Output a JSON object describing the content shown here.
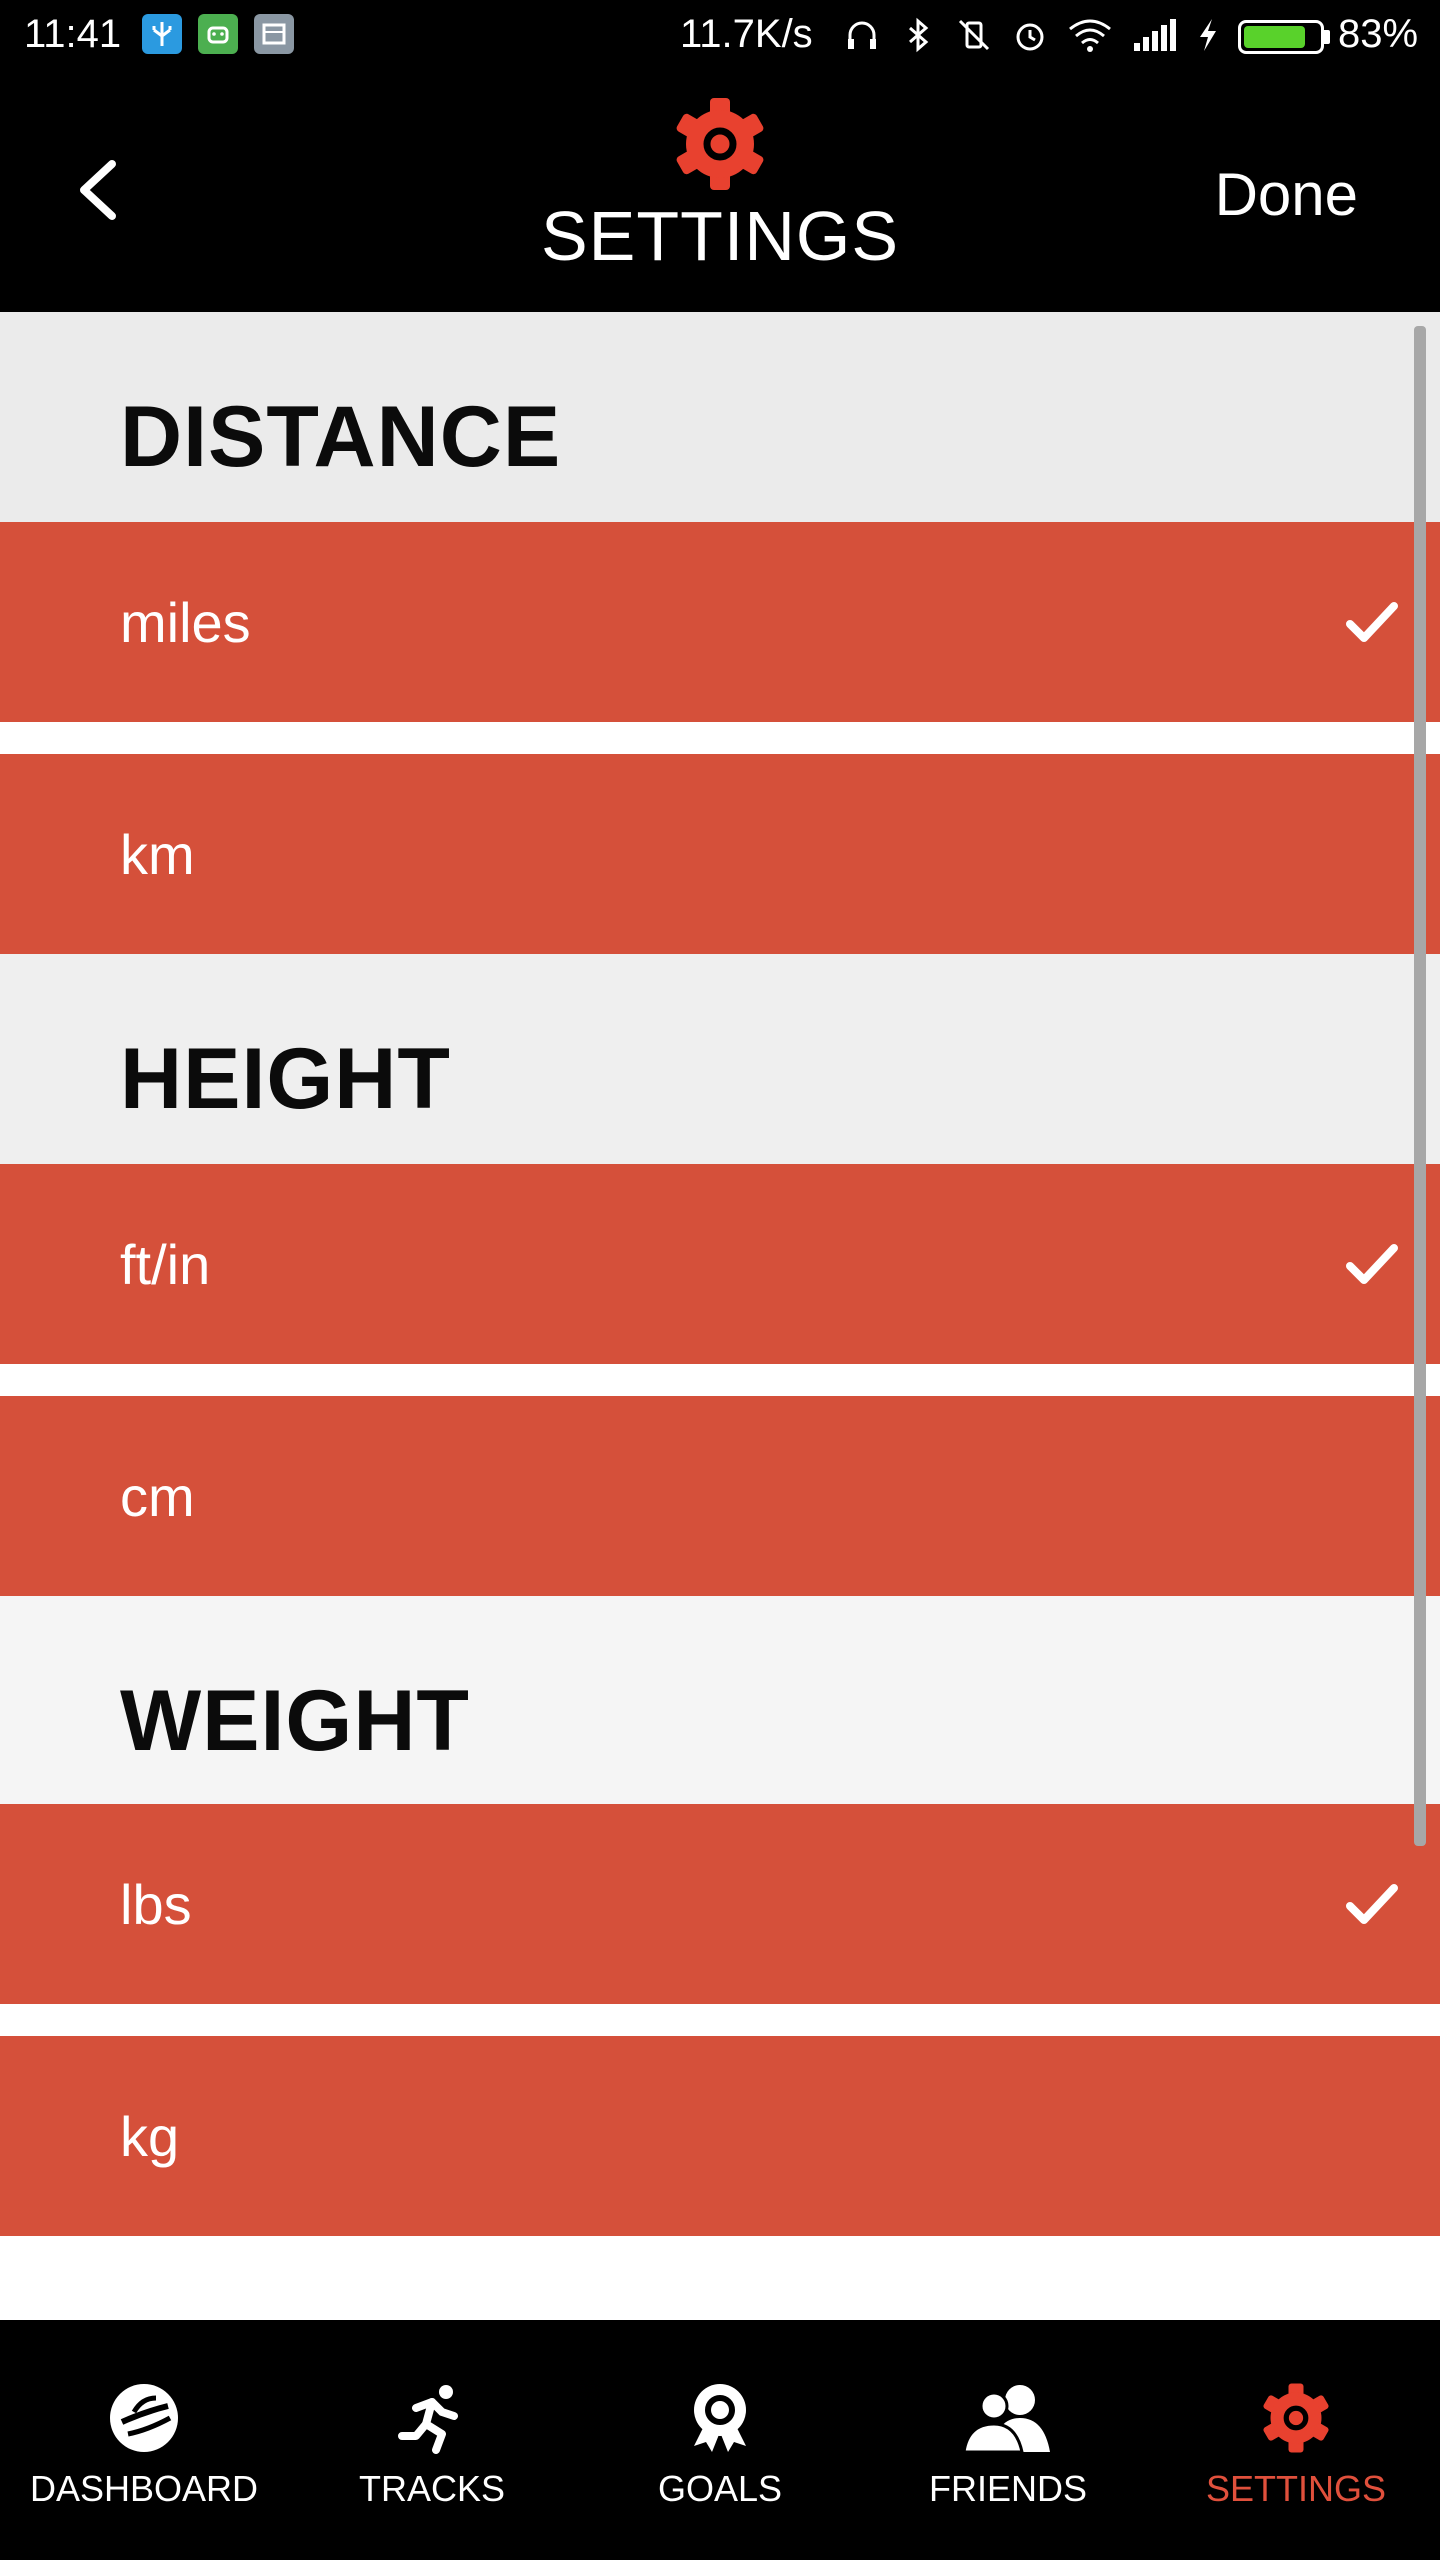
{
  "status_bar": {
    "time": "11:41",
    "network_speed": "11.7K/s",
    "battery_percent": "83%",
    "battery_level": 0.83,
    "icons": [
      "usb-icon",
      "android-icon",
      "message-icon",
      "headphones-icon",
      "bluetooth-icon",
      "vibrate-off-icon",
      "alarm-icon",
      "wifi-icon",
      "signal-icon",
      "charging-icon",
      "battery-icon"
    ]
  },
  "header": {
    "title": "SETTINGS",
    "done_label": "Done",
    "icon": "gear-icon"
  },
  "sections": [
    {
      "title": "DISTANCE",
      "options": [
        {
          "label": "miles",
          "selected": true
        },
        {
          "label": "km",
          "selected": false
        }
      ]
    },
    {
      "title": "HEIGHT",
      "options": [
        {
          "label": "ft/in",
          "selected": true
        },
        {
          "label": "cm",
          "selected": false
        }
      ]
    },
    {
      "title": "WEIGHT",
      "options": [
        {
          "label": "lbs",
          "selected": true
        },
        {
          "label": "kg",
          "selected": false
        }
      ]
    }
  ],
  "bottom_nav": {
    "items": [
      {
        "label": "DASHBOARD",
        "icon": "dashboard-logo-icon",
        "active": false
      },
      {
        "label": "TRACKS",
        "icon": "runner-icon",
        "active": false
      },
      {
        "label": "GOALS",
        "icon": "award-ribbon-icon",
        "active": false
      },
      {
        "label": "FRIENDS",
        "icon": "friends-icon",
        "active": false
      },
      {
        "label": "SETTINGS",
        "icon": "gear-icon",
        "active": true
      }
    ]
  },
  "colors": {
    "accent": "#e0503c",
    "option_background": "#d5503a",
    "bar_background": "#000000",
    "section_background": "#eeeeee",
    "battery_fill": "#59d22b"
  }
}
